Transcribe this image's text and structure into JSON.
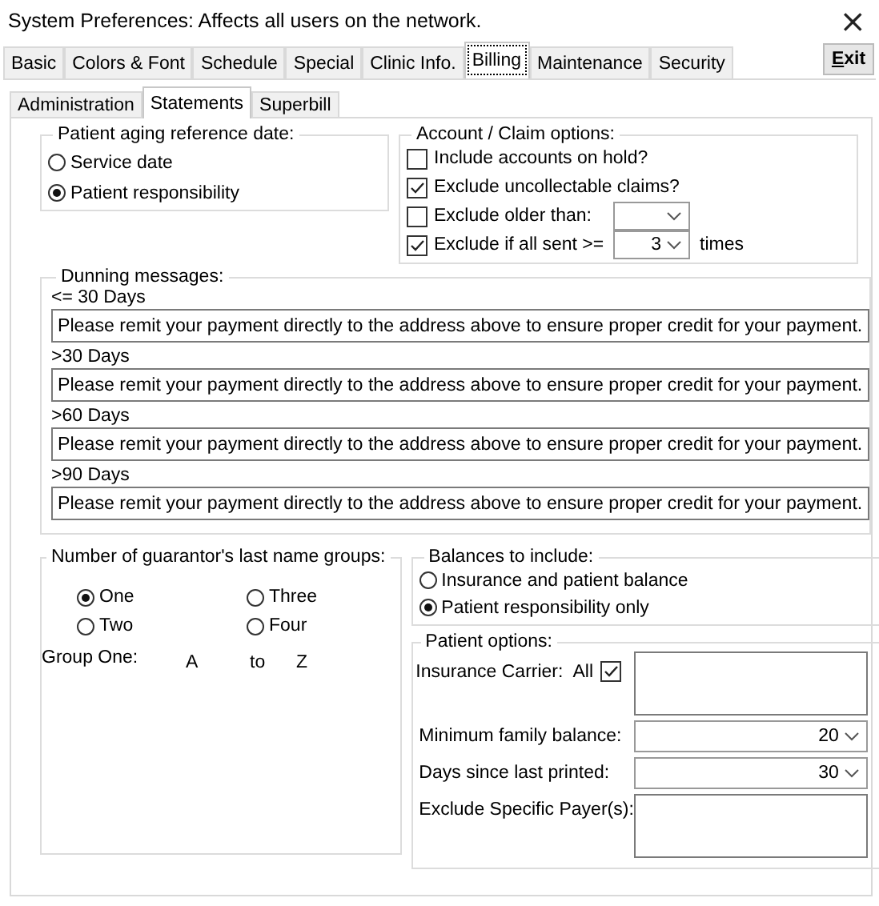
{
  "window": {
    "title": "System Preferences: Affects all users on the network.",
    "close": "×"
  },
  "tabs": [
    {
      "label": "Basic",
      "selected": false
    },
    {
      "label": "Colors & Font",
      "selected": false
    },
    {
      "label": "Schedule",
      "selected": false
    },
    {
      "label": "Special",
      "selected": false
    },
    {
      "label": "Clinic Info.",
      "selected": false
    },
    {
      "label": "Billing",
      "selected": true
    },
    {
      "label": "Maintenance",
      "selected": false
    },
    {
      "label": "Security",
      "selected": false
    }
  ],
  "exit_button": "Exit",
  "subtabs": [
    {
      "label": "Administration",
      "selected": false
    },
    {
      "label": "Statements",
      "selected": true
    },
    {
      "label": "Superbill",
      "selected": false
    }
  ],
  "aging": {
    "title": "Patient aging reference date:",
    "options": [
      {
        "label": "Service date",
        "selected": false
      },
      {
        "label": "Patient responsibility",
        "selected": true
      }
    ]
  },
  "account_options": {
    "title": "Account / Claim options:",
    "items": [
      {
        "kind": "check",
        "label": "Include accounts on hold?",
        "checked": false
      },
      {
        "kind": "check",
        "label": "Exclude uncollectable claims?",
        "checked": true
      },
      {
        "kind": "combo",
        "label": "Exclude older than:",
        "checked": false
      },
      {
        "kind": "combo",
        "label": "Exclude if all sent >=",
        "checked": true,
        "value": "3",
        "suffix": "times"
      }
    ]
  },
  "dunning": {
    "title": "Dunning messages:",
    "messages": [
      {
        "label": "<= 30 Days",
        "text": "Please remit your payment directly to the address above to ensure proper credit for your payment."
      },
      {
        "label": ">30 Days",
        "text": "Please remit your payment directly to the address above to ensure proper credit for your payment."
      },
      {
        "label": ">60 Days",
        "text": "Please remit your payment directly to the address above to ensure proper credit for your payment."
      },
      {
        "label": ">90 Days",
        "text": "Please remit your payment directly to the address above to ensure proper credit for your payment."
      }
    ]
  },
  "name_groups": {
    "title": "Number of guarantor's last name groups:",
    "options": [
      {
        "label": "One",
        "selected": true
      },
      {
        "label": "Two",
        "selected": false
      },
      {
        "label": "Three",
        "selected": false
      },
      {
        "label": "Four",
        "selected": false
      }
    ],
    "group_label": "Group One:",
    "from": "A",
    "to_word": "to",
    "to": "Z"
  },
  "balances": {
    "title": "Balances to include:",
    "options": [
      {
        "label": "Insurance and patient balance",
        "selected": false
      },
      {
        "label": "Patient responsibility only",
        "selected": true
      }
    ]
  },
  "patient_options": {
    "title": "Patient options:",
    "insurance_carrier": {
      "label": "Insurance Carrier:",
      "all_label": "All",
      "all_checked": true
    },
    "min_balance": {
      "label": "Minimum family balance:",
      "value": "20"
    },
    "days_since": {
      "label": "Days since last printed:",
      "value": "30"
    },
    "exclude_payers": {
      "label": "Exclude Specific Payer(s):"
    }
  }
}
